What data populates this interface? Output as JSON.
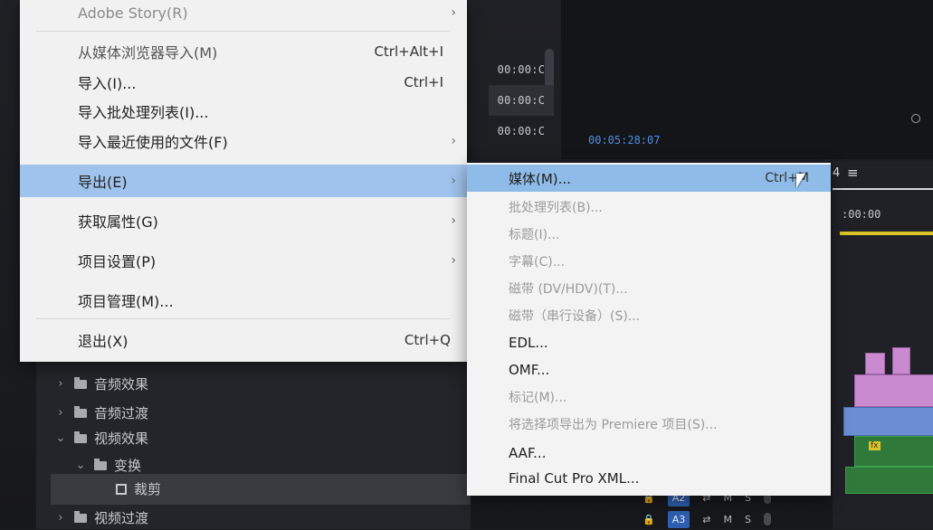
{
  "menu": {
    "items": [
      {
        "label": "Adobe Story(R)",
        "shortcut": "",
        "submenu": true,
        "state": "normal"
      },
      {
        "label": "从媒体浏览器导入(M)",
        "shortcut": "Ctrl+Alt+I",
        "submenu": false,
        "state": "normal"
      },
      {
        "label": "导入(I)...",
        "shortcut": "Ctrl+I",
        "submenu": false,
        "state": "normal"
      },
      {
        "label": "导入批处理列表(I)...",
        "shortcut": "",
        "submenu": false,
        "state": "normal"
      },
      {
        "label": "导入最近使用的文件(F)",
        "shortcut": "",
        "submenu": true,
        "state": "normal"
      },
      {
        "label": "导出(E)",
        "shortcut": "",
        "submenu": true,
        "state": "highlight"
      },
      {
        "label": "获取属性(G)",
        "shortcut": "",
        "submenu": true,
        "state": "normal"
      },
      {
        "label": "项目设置(P)",
        "shortcut": "",
        "submenu": true,
        "state": "normal"
      },
      {
        "label": "项目管理(M)...",
        "shortcut": "",
        "submenu": false,
        "state": "normal"
      },
      {
        "label": "退出(X)",
        "shortcut": "Ctrl+Q",
        "submenu": false,
        "state": "normal"
      }
    ]
  },
  "export_submenu": {
    "items": [
      {
        "label": "媒体(M)...",
        "shortcut": "Ctrl+M",
        "state": "highlight"
      },
      {
        "label": "批处理列表(B)...",
        "shortcut": "",
        "state": "disabled"
      },
      {
        "label": "标题(I)...",
        "shortcut": "",
        "state": "disabled"
      },
      {
        "label": "字幕(C)...",
        "shortcut": "",
        "state": "disabled"
      },
      {
        "label": "磁带 (DV/HDV)(T)...",
        "shortcut": "",
        "state": "disabled"
      },
      {
        "label": "磁带（串行设备）(S)...",
        "shortcut": "",
        "state": "disabled"
      },
      {
        "label": "EDL...",
        "shortcut": "",
        "state": "normal"
      },
      {
        "label": "OMF...",
        "shortcut": "",
        "state": "normal"
      },
      {
        "label": "标记(M)...",
        "shortcut": "",
        "state": "disabled"
      },
      {
        "label": "将选择项导出为 Premiere 项目(S)...",
        "shortcut": "",
        "state": "disabled"
      },
      {
        "label": "AAF...",
        "shortcut": "",
        "state": "normal"
      },
      {
        "label": "Final Cut Pro XML...",
        "shortcut": "",
        "state": "normal"
      }
    ]
  },
  "timecodes": [
    "00:00:C",
    "00:00:C",
    "00:00:C"
  ],
  "monitor": {
    "timecode": "00:05:28:07"
  },
  "timeline": {
    "tab_label": "4",
    "menu_glyph": "≡",
    "ruler_time": ":00:00",
    "fx_badge": "fx"
  },
  "tracks": [
    {
      "name": "A2",
      "icon": "lock-icon",
      "toggle_icon": "sync-icon",
      "m": "M",
      "s": "S"
    },
    {
      "name": "A3",
      "icon": "lock-icon",
      "toggle_icon": "sync-icon",
      "m": "M",
      "s": "S"
    }
  ],
  "effects_tree": [
    {
      "label": "音频效果",
      "expanded": false,
      "indent": 0
    },
    {
      "label": "音频过渡",
      "expanded": false,
      "indent": 0
    },
    {
      "label": "视频效果",
      "expanded": true,
      "indent": 0
    },
    {
      "label": "变换",
      "expanded": true,
      "indent": 1
    },
    {
      "label": "裁剪",
      "expanded": false,
      "indent": 2,
      "selected": true
    },
    {
      "label": "视频过渡",
      "expanded": false,
      "indent": 0
    }
  ],
  "colors": {
    "menu_highlight": "#9fc3ec",
    "timeline_blue_time": "#4f8fe6",
    "playbar": "#d8c52a"
  }
}
